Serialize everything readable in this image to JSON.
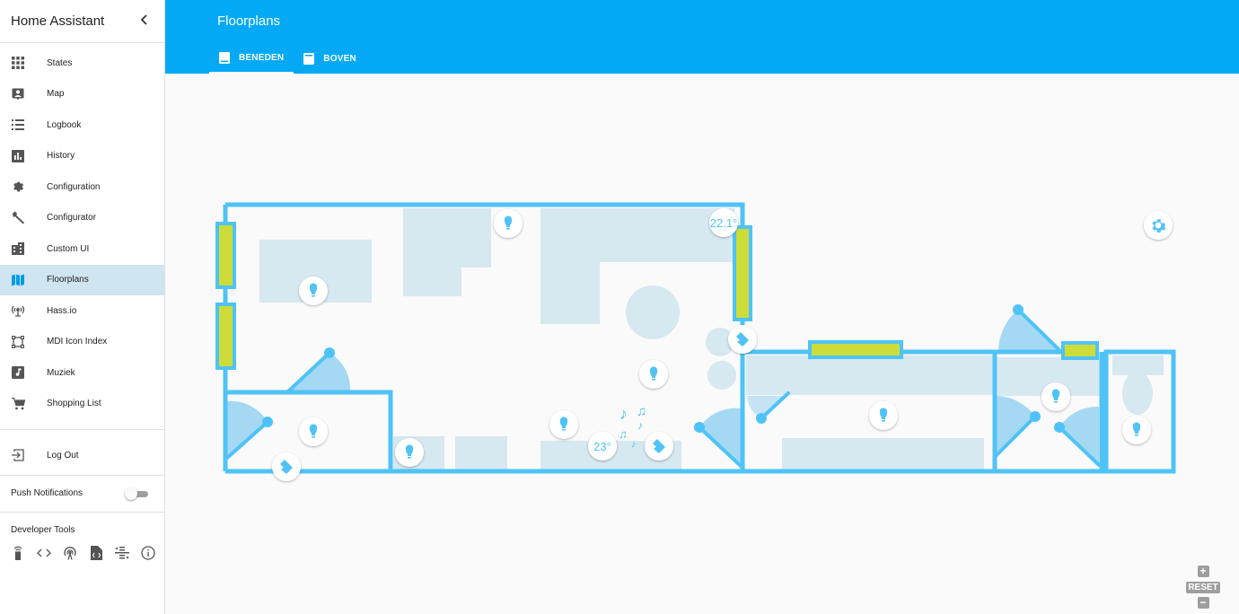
{
  "app": {
    "title": "Home Assistant"
  },
  "sidebar": {
    "items": [
      {
        "label": "States",
        "icon": "grid-icon"
      },
      {
        "label": "Map",
        "icon": "map-account-icon"
      },
      {
        "label": "Logbook",
        "icon": "list-icon"
      },
      {
        "label": "History",
        "icon": "chart-bar-icon"
      },
      {
        "label": "Configuration",
        "icon": "gear-icon"
      },
      {
        "label": "Configurator",
        "icon": "wrench-icon"
      },
      {
        "label": "Custom UI",
        "icon": "city-icon"
      },
      {
        "label": "Floorplans",
        "icon": "map-icon",
        "active": true
      },
      {
        "label": "Hass.io",
        "icon": "antenna-icon"
      },
      {
        "label": "MDI Icon Index",
        "icon": "vector-square-icon"
      },
      {
        "label": "Muziek",
        "icon": "music-box-icon"
      },
      {
        "label": "Shopping List",
        "icon": "cart-icon"
      }
    ],
    "logout_label": "Log Out",
    "push_label": "Push Notifications",
    "push_enabled": false,
    "dev_tools_title": "Developer Tools",
    "dev_tools": [
      "remote-icon",
      "code-brackets-icon",
      "radio-tower-icon",
      "file-xml-icon",
      "format-list-icon",
      "info-icon"
    ]
  },
  "header": {
    "title": "Floorplans",
    "tabs": [
      {
        "label": "BENEDEN",
        "active": true
      },
      {
        "label": "BOVEN",
        "active": false
      }
    ]
  },
  "floorplan": {
    "temperature_1": "22.1°",
    "temperature_2": "23°",
    "colors": {
      "wall": "#4fc3f7",
      "furniture": "#d6e8f0",
      "window": "#cddc39",
      "door": "#7ccaf0"
    }
  },
  "zoom": {
    "reset_label": "RESET",
    "plus": "+",
    "minus": "−"
  }
}
